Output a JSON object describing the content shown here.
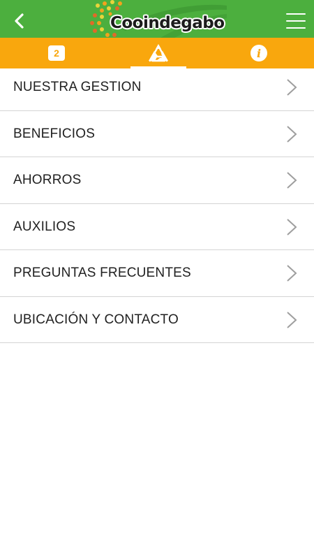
{
  "header": {
    "brand_name": "Cooindegabo",
    "back_icon": "chevron-left-icon",
    "menu_icon": "hamburger-icon",
    "bar_color": "#4caf3e"
  },
  "tabs": {
    "color": "#f9a70d",
    "items": [
      {
        "label": "2",
        "icon": "count-badge-icon"
      },
      {
        "label": "",
        "icon": "triangle-logo-icon",
        "active": true
      },
      {
        "label": "i",
        "icon": "info-icon"
      }
    ]
  },
  "menu": {
    "items": [
      {
        "label": "NUESTRA GESTION"
      },
      {
        "label": "BENEFICIOS"
      },
      {
        "label": "AHORROS"
      },
      {
        "label": "AUXILIOS"
      },
      {
        "label": "PREGUNTAS FRECUENTES"
      },
      {
        "label": "UBICACIÓN Y CONTACTO"
      }
    ]
  }
}
